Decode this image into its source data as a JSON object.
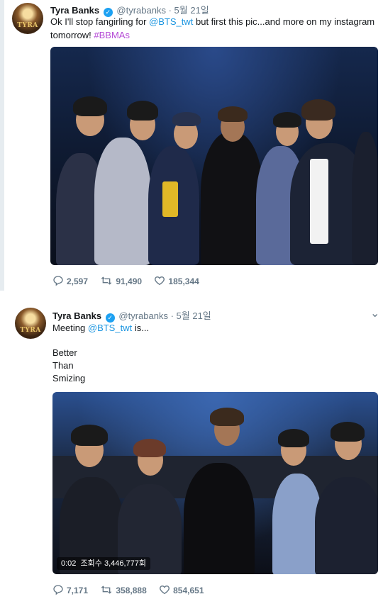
{
  "tweets": [
    {
      "author": {
        "name": "Tyra Banks",
        "handle": "@tyrabanks",
        "date": "5월 21일",
        "avatar_label": "TYRA"
      },
      "separator": "·",
      "text_parts": [
        "Ok I'll stop fangirling for ",
        "@BTS_twt",
        " but first this pic...and more on my instagram tomorrow! ",
        "#BBMAs"
      ],
      "media": {
        "kind": "photo"
      },
      "stats": {
        "replies": "2,597",
        "retweets": "91,490",
        "likes": "185,344"
      }
    },
    {
      "author": {
        "name": "Tyra Banks",
        "handle": "@tyrabanks",
        "date": "5월 21일",
        "avatar_label": "TYRA"
      },
      "separator": "·",
      "text_parts": [
        "Meeting ",
        "@BTS_twt",
        " is..."
      ],
      "lines": [
        "Better",
        "Than",
        "Smizing"
      ],
      "media": {
        "kind": "video",
        "time": "0:02",
        "views": "조회수 3,446,777회"
      },
      "stats": {
        "replies": "7,171",
        "retweets": "358,888",
        "likes": "854,651"
      }
    }
  ],
  "icons": {
    "reply": "reply-icon",
    "retweet": "retweet-icon",
    "like": "heart-icon",
    "caret": "chevron-down-icon",
    "verified": "verified-badge-icon"
  },
  "colors": {
    "link": "#1b95e0",
    "hashtag": "#b54ad6",
    "verified": "#1da1f2",
    "muted": "#657786"
  }
}
